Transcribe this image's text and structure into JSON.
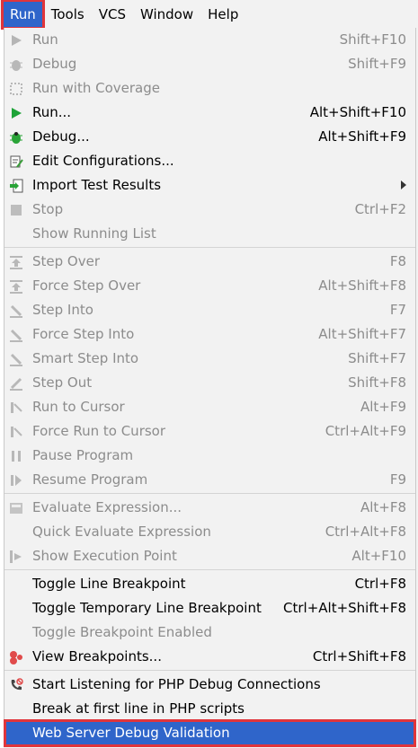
{
  "menubar": {
    "run": "Run",
    "tools": "Tools",
    "vcs": "VCS",
    "window": "Window",
    "help": "Help"
  },
  "menu": {
    "items": [
      {
        "label": "Run",
        "shortcut": "Shift+F10",
        "disabled": true,
        "icon": "play-icon"
      },
      {
        "label": "Debug",
        "shortcut": "Shift+F9",
        "disabled": true,
        "icon": "bug-icon"
      },
      {
        "label": "Run with Coverage",
        "shortcut": "",
        "disabled": true,
        "icon": "coverage-icon"
      },
      {
        "label": "Run...",
        "shortcut": "Alt+Shift+F10",
        "disabled": false,
        "icon": "play-icon"
      },
      {
        "label": "Debug...",
        "shortcut": "Alt+Shift+F9",
        "disabled": false,
        "icon": "bug-icon"
      },
      {
        "label": "Edit Configurations...",
        "shortcut": "",
        "disabled": false,
        "icon": "edit-config-icon"
      },
      {
        "label": "Import Test Results",
        "shortcut": "",
        "disabled": false,
        "icon": "import-icon",
        "submenu": true
      },
      {
        "label": "Stop",
        "shortcut": "Ctrl+F2",
        "disabled": true,
        "icon": "stop-icon"
      },
      {
        "label": "Show Running List",
        "shortcut": "",
        "disabled": true,
        "icon": ""
      },
      {
        "label": "Step Over",
        "shortcut": "F8",
        "disabled": true,
        "icon": "step-over-icon"
      },
      {
        "label": "Force Step Over",
        "shortcut": "Alt+Shift+F8",
        "disabled": true,
        "icon": "force-step-over-icon"
      },
      {
        "label": "Step Into",
        "shortcut": "F7",
        "disabled": true,
        "icon": "step-into-icon"
      },
      {
        "label": "Force Step Into",
        "shortcut": "Alt+Shift+F7",
        "disabled": true,
        "icon": "force-step-into-icon"
      },
      {
        "label": "Smart Step Into",
        "shortcut": "Shift+F7",
        "disabled": true,
        "icon": "smart-step-into-icon"
      },
      {
        "label": "Step Out",
        "shortcut": "Shift+F8",
        "disabled": true,
        "icon": "step-out-icon"
      },
      {
        "label": "Run to Cursor",
        "shortcut": "Alt+F9",
        "disabled": true,
        "icon": "run-to-cursor-icon"
      },
      {
        "label": "Force Run to Cursor",
        "shortcut": "Ctrl+Alt+F9",
        "disabled": true,
        "icon": "force-run-to-cursor-icon"
      },
      {
        "label": "Pause Program",
        "shortcut": "",
        "disabled": true,
        "icon": "pause-icon"
      },
      {
        "label": "Resume Program",
        "shortcut": "F9",
        "disabled": true,
        "icon": "resume-icon"
      },
      {
        "label": "Evaluate Expression...",
        "shortcut": "Alt+F8",
        "disabled": true,
        "icon": "calculator-icon"
      },
      {
        "label": "Quick Evaluate Expression",
        "shortcut": "Ctrl+Alt+F8",
        "disabled": true,
        "icon": ""
      },
      {
        "label": "Show Execution Point",
        "shortcut": "Alt+F10",
        "disabled": true,
        "icon": "execution-point-icon"
      },
      {
        "label": "Toggle Line Breakpoint",
        "shortcut": "Ctrl+F8",
        "disabled": false,
        "icon": ""
      },
      {
        "label": "Toggle Temporary Line Breakpoint",
        "shortcut": "Ctrl+Alt+Shift+F8",
        "disabled": false,
        "icon": ""
      },
      {
        "label": "Toggle Breakpoint Enabled",
        "shortcut": "",
        "disabled": true,
        "icon": ""
      },
      {
        "label": "View Breakpoints...",
        "shortcut": "Ctrl+Shift+F8",
        "disabled": false,
        "icon": "breakpoints-icon"
      },
      {
        "label": "Start Listening for PHP Debug Connections",
        "shortcut": "",
        "disabled": false,
        "icon": "phone-icon"
      },
      {
        "label": "Break at first line in PHP scripts",
        "shortcut": "",
        "disabled": false,
        "icon": ""
      },
      {
        "label": "Web Server Debug Validation",
        "shortcut": "",
        "disabled": false,
        "icon": "",
        "selected": true
      }
    ]
  },
  "colors": {
    "selection": "#2f65ca",
    "highlight_border": "#e0353b",
    "disabled_text": "#8c8c8c"
  }
}
